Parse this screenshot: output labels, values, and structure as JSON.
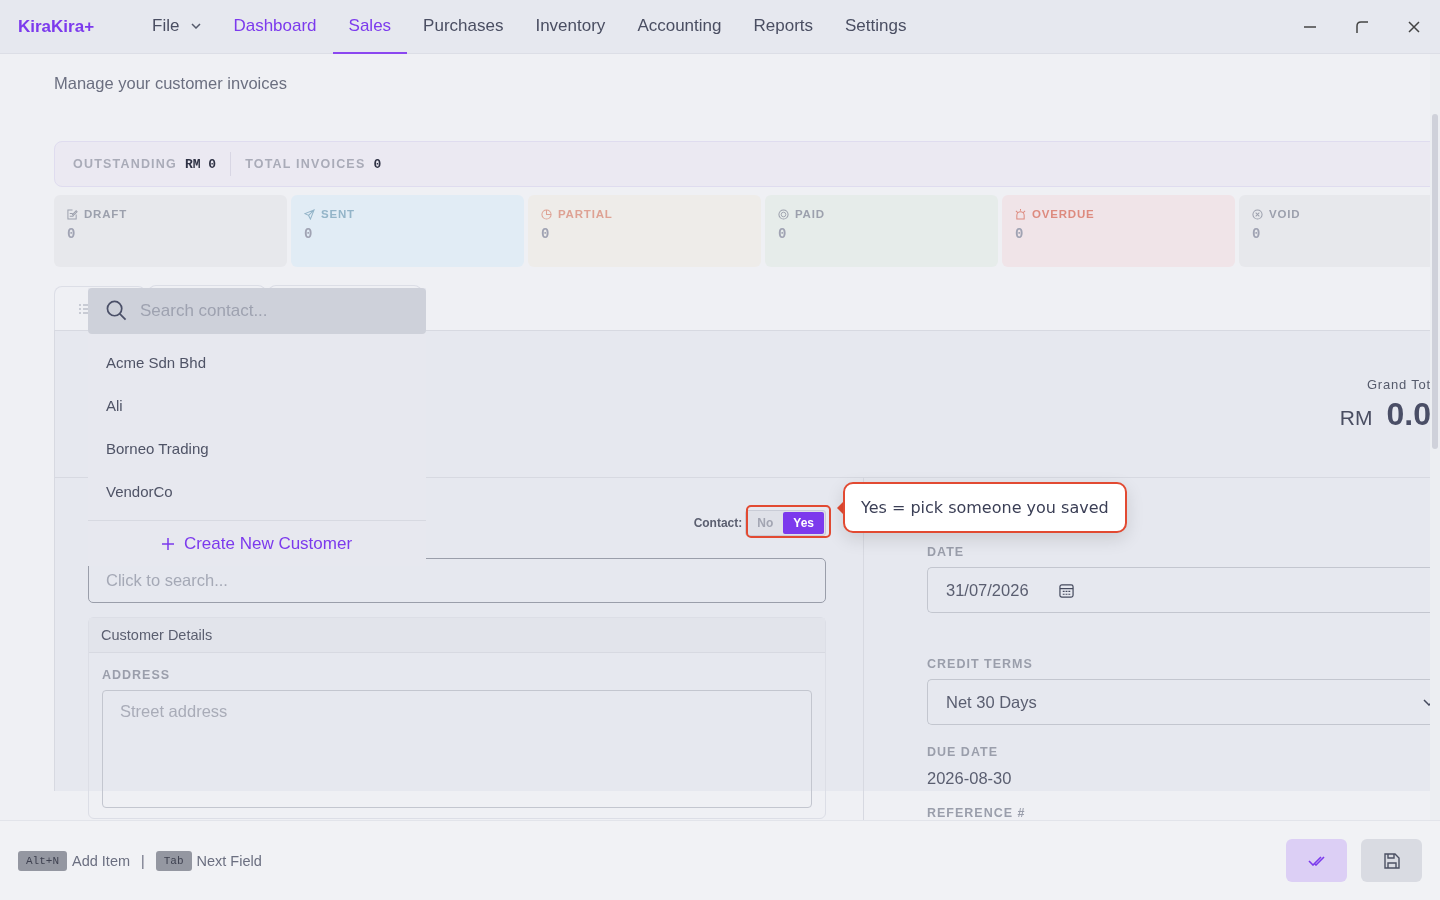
{
  "app": {
    "logo": "KiraKira+"
  },
  "menu": [
    {
      "label": "File",
      "kind": "dropdown",
      "selected": false
    },
    {
      "label": "Dashboard",
      "kind": "accent",
      "selected": false
    },
    {
      "label": "Sales",
      "kind": "plain",
      "selected": true
    },
    {
      "label": "Purchases",
      "kind": "plain",
      "selected": false
    },
    {
      "label": "Inventory",
      "kind": "plain",
      "selected": false
    },
    {
      "label": "Accounting",
      "kind": "plain",
      "selected": false
    },
    {
      "label": "Reports",
      "kind": "plain",
      "selected": false
    },
    {
      "label": "Settings",
      "kind": "plain",
      "selected": false
    }
  ],
  "page": {
    "subtitle": "Manage your customer invoices"
  },
  "summary": [
    {
      "label": "OUTSTANDING",
      "value": "RM 0"
    },
    {
      "label": "TOTAL INVOICES",
      "value": "0"
    }
  ],
  "status_cards": [
    {
      "label": "DRAFT",
      "count": "0",
      "kind": "draft",
      "color": "#9ca0ad"
    },
    {
      "label": "SENT",
      "count": "0",
      "kind": "sent",
      "color": "#93b4c8"
    },
    {
      "label": "PARTIAL",
      "count": "0",
      "kind": "partial",
      "color": "#dea294"
    },
    {
      "label": "PAID",
      "count": "0",
      "kind": "paid",
      "color": "#9ca0ad"
    },
    {
      "label": "OVERDUE",
      "count": "0",
      "kind": "overdue",
      "color": "#dd8a7e"
    },
    {
      "label": "VOID",
      "count": "0",
      "kind": "void",
      "color": "#9ca0ad"
    }
  ],
  "contact_search": {
    "placeholder": "Search contact...",
    "options": [
      "Acme Sdn Bhd",
      "Ali",
      "Borneo Trading",
      "VendorCo"
    ],
    "create_label": "Create New Customer"
  },
  "grand_total": {
    "label": "Grand Tot",
    "currency": "RM",
    "amount": "0.0"
  },
  "contact_toggle": {
    "label": "Contact:",
    "options": [
      {
        "label": "No",
        "selected": false
      },
      {
        "label": "Yes",
        "selected": true
      }
    ]
  },
  "tooltip": {
    "text": "Yes = pick someone you saved"
  },
  "customer_field": {
    "placeholder": "Click to search..."
  },
  "customer_details": {
    "title": "Customer Details",
    "address_label": "ADDRESS",
    "address_placeholder": "Street address"
  },
  "invoice_fields": {
    "date_label": "DATE",
    "date_value": "31/07/2026",
    "terms_label": "CREDIT TERMS",
    "terms_value": "Net 30 Days",
    "due_label": "DUE DATE",
    "due_value": "2026-08-30",
    "reference_label": "REFERENCE #"
  },
  "shortcuts": [
    {
      "key": "Alt+N",
      "label": "Add Item"
    },
    {
      "key": "Tab",
      "label": "Next Field"
    }
  ],
  "shortcut_separator": "|"
}
